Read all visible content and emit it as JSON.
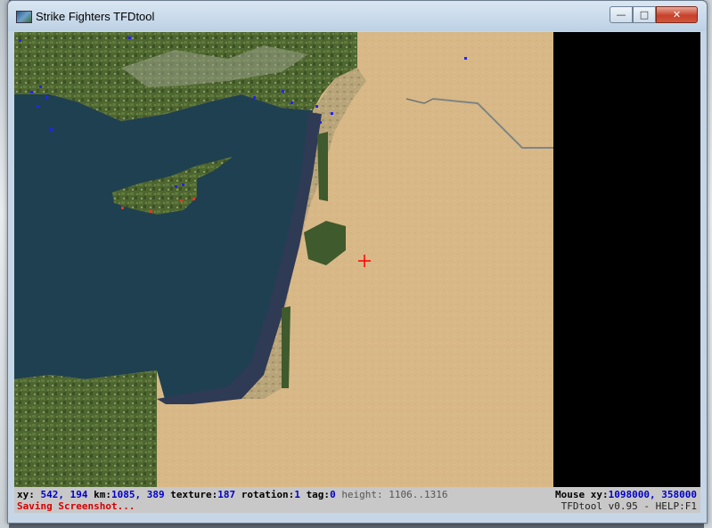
{
  "window": {
    "title": "Strike Fighters TFDtool"
  },
  "status": {
    "xy_label": "xy:",
    "xy_value": "542, 194",
    "km_label": "km:",
    "km_value": "1085, 389",
    "texture_label": "texture:",
    "texture_value": "187",
    "rotation_label": "rotation:",
    "rotation_value": "1",
    "tag_label": "tag:",
    "tag_value": "0",
    "height_text": "height: 1106..1316",
    "mouse_label": "Mouse xy:",
    "mouse_value": "1098000, 358000",
    "message": "Saving Screenshot...",
    "version": "TFDtool v0.95 - HELP:F1"
  },
  "colors": {
    "sea": "#1f4050",
    "coast": "#2f3a55",
    "desert": "#d8b887",
    "forest": "#4e6630",
    "cursor": "#ff0000",
    "marker_blue": "#2323ff",
    "marker_red": "#e03a1f"
  }
}
